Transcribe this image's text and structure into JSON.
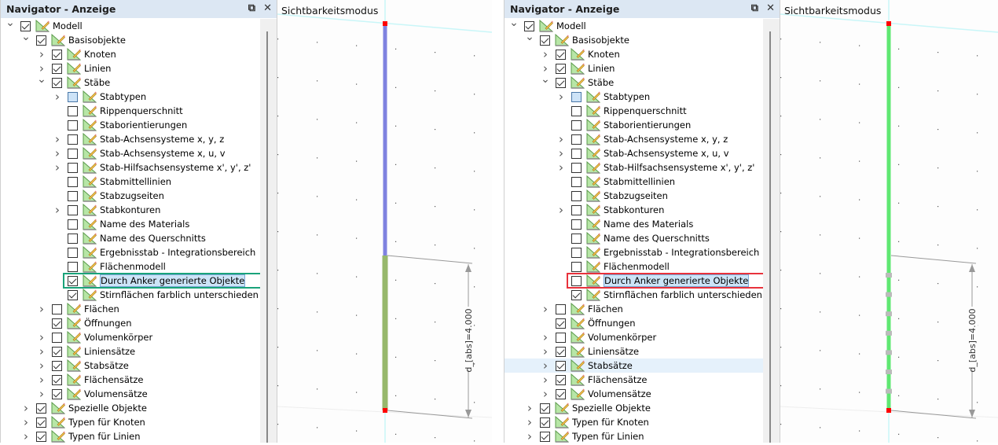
{
  "panels": [
    {
      "header": {
        "title": "Navigator - Anzeige",
        "restore_icon": "restore-icon",
        "close_icon": "close-icon"
      },
      "highlight": {
        "row": 18,
        "color": "#1aa37a"
      },
      "hover_row": null,
      "tree": [
        {
          "label": "Modell",
          "level": 0,
          "exp": "open",
          "check": "checked"
        },
        {
          "label": "Basisobjekte",
          "level": 1,
          "exp": "open",
          "check": "checked"
        },
        {
          "label": "Knoten",
          "level": 2,
          "exp": "closed",
          "check": "checked"
        },
        {
          "label": "Linien",
          "level": 2,
          "exp": "closed",
          "check": "checked"
        },
        {
          "label": "Stäbe",
          "level": 2,
          "exp": "open",
          "check": "checked"
        },
        {
          "label": "Stabtypen",
          "level": 3,
          "exp": "closed",
          "check": "partial"
        },
        {
          "label": "Rippenquerschnitt",
          "level": 3,
          "exp": "none",
          "check": "unchecked"
        },
        {
          "label": "Staborientierungen",
          "level": 3,
          "exp": "none",
          "check": "unchecked"
        },
        {
          "label": "Stab-Achsensysteme x, y, z",
          "level": 3,
          "exp": "closed",
          "check": "unchecked"
        },
        {
          "label": "Stab-Achsensysteme x, u, v",
          "level": 3,
          "exp": "closed",
          "check": "unchecked"
        },
        {
          "label": "Stab-Hilfsachsensysteme x', y', z'",
          "level": 3,
          "exp": "closed",
          "check": "unchecked"
        },
        {
          "label": "Stabmittellinien",
          "level": 3,
          "exp": "none",
          "check": "unchecked"
        },
        {
          "label": "Stabzugseiten",
          "level": 3,
          "exp": "none",
          "check": "unchecked"
        },
        {
          "label": "Stabkonturen",
          "level": 3,
          "exp": "closed",
          "check": "unchecked"
        },
        {
          "label": "Name des Materials",
          "level": 3,
          "exp": "none",
          "check": "unchecked"
        },
        {
          "label": "Name des Querschnitts",
          "level": 3,
          "exp": "none",
          "check": "unchecked"
        },
        {
          "label": "Ergebnisstab - Integrationsbereich",
          "level": 3,
          "exp": "none",
          "check": "unchecked"
        },
        {
          "label": "Flächenmodell",
          "level": 3,
          "exp": "none",
          "check": "unchecked"
        },
        {
          "label": "Durch Anker generierte Objekte",
          "level": 3,
          "exp": "none",
          "check": "checked",
          "selected": true
        },
        {
          "label": "Stirnflächen farblich unterschieden",
          "level": 3,
          "exp": "none",
          "check": "checked"
        },
        {
          "label": "Flächen",
          "level": 2,
          "exp": "closed",
          "check": "unchecked"
        },
        {
          "label": "Öffnungen",
          "level": 2,
          "exp": "none",
          "check": "checked"
        },
        {
          "label": "Volumenkörper",
          "level": 2,
          "exp": "closed",
          "check": "unchecked"
        },
        {
          "label": "Liniensätze",
          "level": 2,
          "exp": "closed",
          "check": "checked"
        },
        {
          "label": "Stabsätze",
          "level": 2,
          "exp": "closed",
          "check": "checked"
        },
        {
          "label": "Flächensätze",
          "level": 2,
          "exp": "closed",
          "check": "checked"
        },
        {
          "label": "Volumensätze",
          "level": 2,
          "exp": "closed",
          "check": "checked"
        },
        {
          "label": "Spezielle Objekte",
          "level": 1,
          "exp": "closed",
          "check": "checked"
        },
        {
          "label": "Typen für Knoten",
          "level": 1,
          "exp": "closed",
          "check": "checked"
        },
        {
          "label": "Typen für Linien",
          "level": 1,
          "exp": "closed",
          "check": "checked"
        }
      ],
      "viewport": {
        "title": "Sichtbarkeitsmodus",
        "dimension_label": "d_[abs]=4.000",
        "upper_member_color": "#7f82e0",
        "lower_member_color": "#97b86c",
        "anchor_markers": false
      }
    },
    {
      "header": {
        "title": "Navigator - Anzeige",
        "restore_icon": "restore-icon",
        "close_icon": "close-icon"
      },
      "highlight": {
        "row": 18,
        "color": "#e8323c"
      },
      "hover_row": 24,
      "viewport": {
        "title": "Sichtbarkeitsmodus",
        "dimension_label": "d_[abs]=4.000",
        "upper_member_color": "#5fe872",
        "lower_member_color": "#5fe872",
        "anchor_markers": true
      },
      "checked_override": {
        "row": 18,
        "check": "unchecked"
      }
    }
  ]
}
